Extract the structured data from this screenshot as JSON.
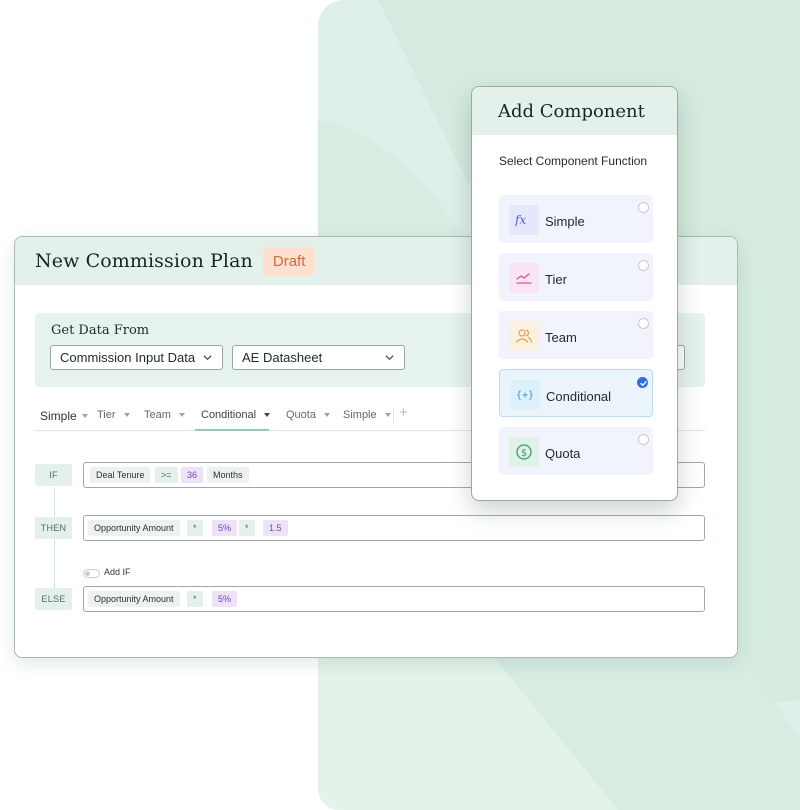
{
  "plan": {
    "title": "New Commission Plan",
    "status": "Draft",
    "data_source": {
      "label": "Get Data From",
      "source_select": "Commission Input Data",
      "dataset_select": "AE Datasheet"
    },
    "tabs": [
      {
        "label": "Simple"
      },
      {
        "label": "Tier"
      },
      {
        "label": "Team"
      },
      {
        "label": "Conditional",
        "active": true
      },
      {
        "label": "Quota"
      },
      {
        "label": "Simple"
      }
    ],
    "add_tab": "+",
    "rules": {
      "if": {
        "tag": "IF",
        "field": "Deal Tenure",
        "operator": ">=",
        "value": "36",
        "unit": "Months"
      },
      "then": {
        "tag": "THEN",
        "field": "Opportunity Amount",
        "op1": "*",
        "value1": "5%",
        "op2": "*",
        "value2": "1.5"
      },
      "add_if_label": "Add IF",
      "else": {
        "tag": "ELSE",
        "field": "Opportunity Amount",
        "operator": "*",
        "value": "5%"
      }
    }
  },
  "add_component": {
    "title": "Add Component",
    "subtitle": "Select Component Function",
    "options": [
      {
        "label": "Simple",
        "icon": "fx-icon",
        "selected": false
      },
      {
        "label": "Tier",
        "icon": "line-chart-icon",
        "selected": false
      },
      {
        "label": "Team",
        "icon": "users-icon",
        "selected": false
      },
      {
        "label": "Conditional",
        "icon": "braces-plus-icon",
        "selected": true
      },
      {
        "label": "Quota",
        "icon": "dollar-circle-icon",
        "selected": false
      }
    ]
  },
  "colors": {
    "accent_green": "#e3f1ea",
    "draft_badge_bg": "#fde0cf",
    "draft_badge_text": "#d66a3c",
    "number_chip_bg": "#ece3f8",
    "number_chip_text": "#7a3fb5",
    "selected_radio": "#2f6ee8",
    "background_panel": "#dff0e8"
  }
}
